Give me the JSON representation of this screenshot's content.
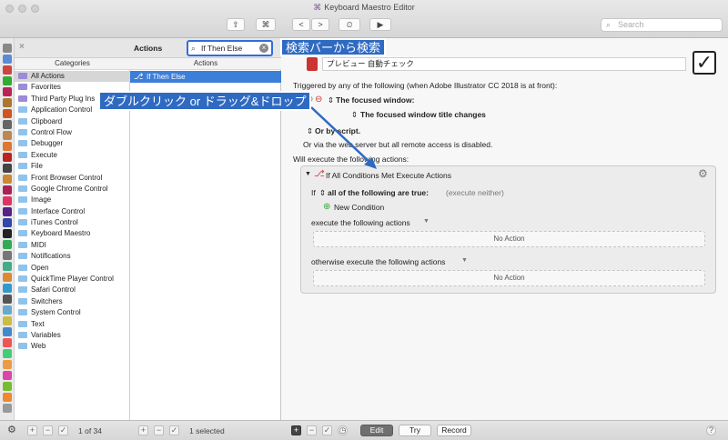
{
  "window": {
    "title": "Keyboard Maestro Editor"
  },
  "toolbar": {
    "share_icon": "⇧",
    "cmd_icon": "⌘",
    "back_icon": "<",
    "forward_icon": ">",
    "history_icon": "⏲",
    "run_icon": "▶",
    "search_placeholder": "Search"
  },
  "categories": {
    "header": "Categories",
    "items": [
      "All Actions",
      "Favorites",
      "Third Party Plug Ins",
      "Application Control",
      "Clipboard",
      "Control Flow",
      "Debugger",
      "Execute",
      "File",
      "Front Browser Control",
      "Google Chrome Control",
      "Image",
      "Interface Control",
      "iTunes Control",
      "Keyboard Maestro",
      "MIDI",
      "Notifications",
      "Open",
      "QuickTime Player Control",
      "Safari Control",
      "Switchers",
      "System Control",
      "Text",
      "Variables",
      "Web"
    ]
  },
  "actions": {
    "title": "Actions",
    "header": "Actions",
    "search_value": "If Then Else",
    "items": [
      "If Then Else"
    ]
  },
  "editor": {
    "macro_name": "プレビュー 自動チェック",
    "trigger_line": "Triggered by any of the following (when Adobe Illustrator CC 2018 is at front):",
    "trigger_name": "The focused window:",
    "trigger_detail": "The focused window title changes",
    "or_script": "Or by script.",
    "web_line": "Or via the web server but all remote access is disabled.",
    "will_execute": "Will execute the following actions:",
    "action_title": "If All Conditions Met Execute Actions",
    "if_label": "If",
    "condition_mode": "all of the following are true:",
    "execute_neither": "(execute neither)",
    "new_condition": "New Condition",
    "then_label": "execute the following actions",
    "otherwise_label": "otherwise execute the following actions",
    "no_action": "No Action"
  },
  "callouts": {
    "search": "検索バーから検索",
    "drag": "ダブルクリック or ドラッグ&ドロップ"
  },
  "bottom": {
    "count": "1 of 34",
    "selected": "1 selected",
    "edit": "Edit",
    "try": "Try",
    "record": "Record",
    "help": "?"
  },
  "colors": {
    "accent": "#3d7ed8",
    "callout": "#2f6ac2"
  }
}
